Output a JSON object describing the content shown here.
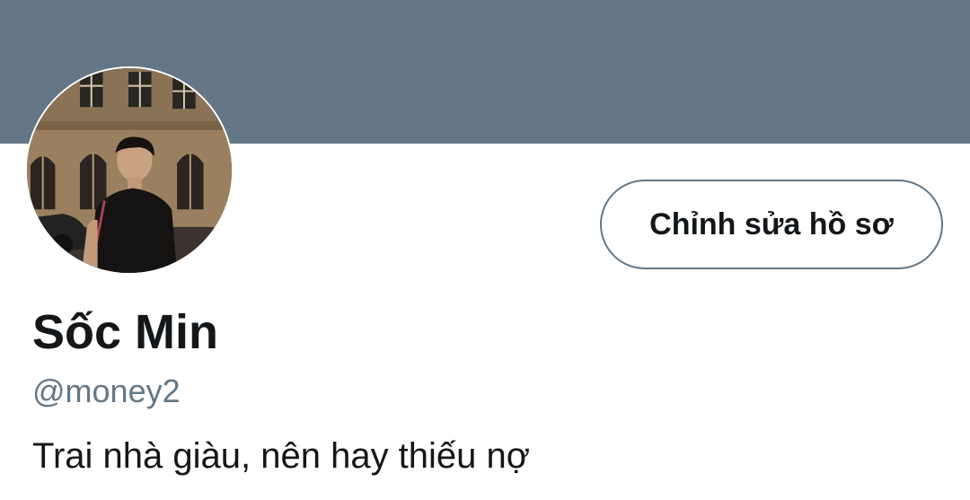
{
  "colors": {
    "banner": "#657786",
    "text_primary": "#14171a",
    "text_secondary": "#657786",
    "button_border": "#657786",
    "background": "#ffffff"
  },
  "profile": {
    "display_name": "Sốc Min",
    "handle": "@money2",
    "bio": "Trai nhà giàu, nên hay thiếu nợ"
  },
  "actions": {
    "edit_profile_label": "Chỉnh sửa hồ sơ"
  },
  "avatar": {
    "icon": "profile-photo"
  }
}
